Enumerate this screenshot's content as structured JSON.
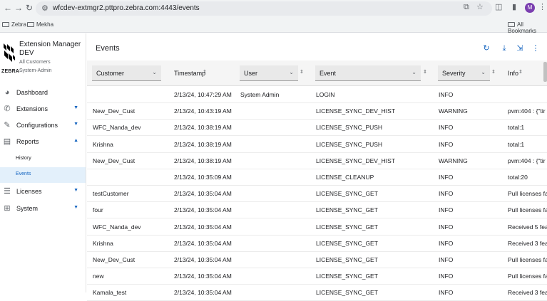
{
  "browser": {
    "url": "wfcdev-extmgr2.pttpro.zebra.com:4443/events",
    "bookmarks": [
      "Zebra",
      "Mekha"
    ],
    "all_bookmarks": "All Bookmarks",
    "profile_initial": "M"
  },
  "app": {
    "name": "Extension Manager DEV",
    "customer": "All Customers",
    "role": "System-Admin",
    "logo_text": "ZEBRA"
  },
  "sidebar": {
    "items": [
      {
        "label": "Dashboard",
        "icon": "dashboard-icon"
      },
      {
        "label": "Extensions",
        "icon": "phone-icon",
        "caret": "▼"
      },
      {
        "label": "Configurations",
        "icon": "edit-icon",
        "caret": "▼"
      },
      {
        "label": "Reports",
        "icon": "report-icon",
        "caret": "▲"
      },
      {
        "label": "Licenses",
        "icon": "list-icon",
        "caret": "▼"
      },
      {
        "label": "System",
        "icon": "network-icon",
        "caret": "▼"
      }
    ],
    "sub_items": [
      {
        "label": "History"
      },
      {
        "label": "Events"
      }
    ]
  },
  "main": {
    "title": "Events",
    "columns": {
      "customer": "Customer",
      "timestamp": "Timestamp",
      "user": "User",
      "event": "Event",
      "severity": "Severity",
      "info": "Info"
    },
    "rows": [
      {
        "customer": "",
        "timestamp": "2/13/24, 10:47:29 AM",
        "user": "System Admin",
        "event": "LOGIN",
        "severity": "INFO",
        "info": ""
      },
      {
        "customer": "New_Dev_Cust",
        "timestamp": "2/13/24, 10:43:19 AM",
        "user": "",
        "event": "LICENSE_SYNC_DEV_HIST",
        "severity": "WARNING",
        "info": "pvm:404 : {\"tir"
      },
      {
        "customer": "WFC_Nanda_dev",
        "timestamp": "2/13/24, 10:38:19 AM",
        "user": "",
        "event": "LICENSE_SYNC_PUSH",
        "severity": "INFO",
        "info": "total:1"
      },
      {
        "customer": "Krishna",
        "timestamp": "2/13/24, 10:38:19 AM",
        "user": "",
        "event": "LICENSE_SYNC_PUSH",
        "severity": "INFO",
        "info": "total:1"
      },
      {
        "customer": "New_Dev_Cust",
        "timestamp": "2/13/24, 10:38:19 AM",
        "user": "",
        "event": "LICENSE_SYNC_DEV_HIST",
        "severity": "WARNING",
        "info": "pvm:404 : {\"tir"
      },
      {
        "customer": "",
        "timestamp": "2/13/24, 10:35:09 AM",
        "user": "",
        "event": "LICENSE_CLEANUP",
        "severity": "INFO",
        "info": "total:20"
      },
      {
        "customer": "testCustomer",
        "timestamp": "2/13/24, 10:35:04 AM",
        "user": "",
        "event": "LICENSE_SYNC_GET",
        "severity": "INFO",
        "info": "Pull licenses fa"
      },
      {
        "customer": "four",
        "timestamp": "2/13/24, 10:35:04 AM",
        "user": "",
        "event": "LICENSE_SYNC_GET",
        "severity": "INFO",
        "info": "Pull licenses fa"
      },
      {
        "customer": "WFC_Nanda_dev",
        "timestamp": "2/13/24, 10:35:04 AM",
        "user": "",
        "event": "LICENSE_SYNC_GET",
        "severity": "INFO",
        "info": "Received 5 fea"
      },
      {
        "customer": "Krishna",
        "timestamp": "2/13/24, 10:35:04 AM",
        "user": "",
        "event": "LICENSE_SYNC_GET",
        "severity": "INFO",
        "info": "Received 3 fea"
      },
      {
        "customer": "New_Dev_Cust",
        "timestamp": "2/13/24, 10:35:04 AM",
        "user": "",
        "event": "LICENSE_SYNC_GET",
        "severity": "INFO",
        "info": "Pull licenses fa"
      },
      {
        "customer": "new",
        "timestamp": "2/13/24, 10:35:04 AM",
        "user": "",
        "event": "LICENSE_SYNC_GET",
        "severity": "INFO",
        "info": "Pull licenses fa"
      },
      {
        "customer": "Kamala_test",
        "timestamp": "2/13/24, 10:35:04 AM",
        "user": "",
        "event": "LICENSE_SYNC_GET",
        "severity": "INFO",
        "info": "Received 3 fea"
      }
    ]
  }
}
